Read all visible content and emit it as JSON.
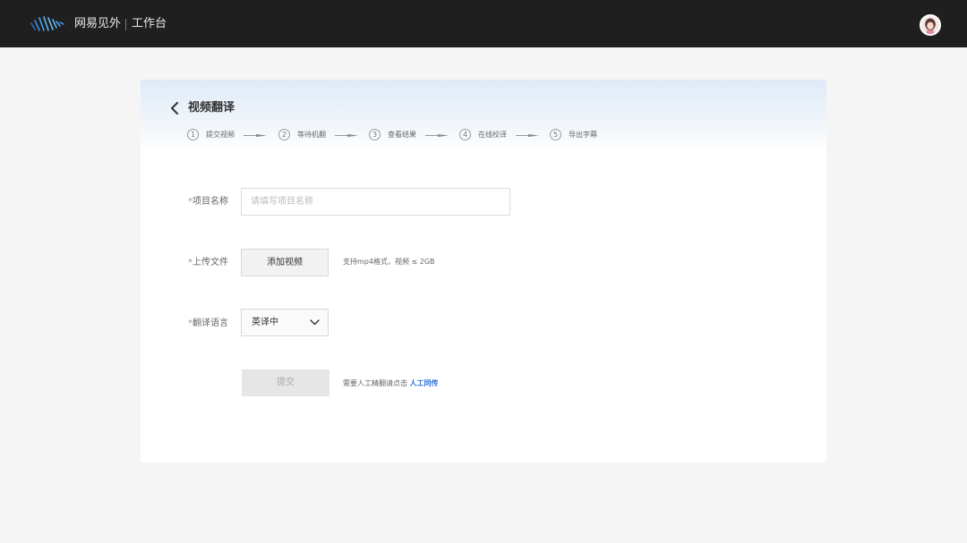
{
  "header": {
    "logo_icon": "wave-logo-icon",
    "brand": "网易见外",
    "workspace": "工作台",
    "avatar_icon": "user-avatar-icon"
  },
  "page": {
    "title": "视频翻译",
    "back_icon": "chevron-left-icon",
    "steps": [
      {
        "num": "1",
        "label": "提交视频"
      },
      {
        "num": "2",
        "label": "等待机翻"
      },
      {
        "num": "3",
        "label": "查看结果"
      },
      {
        "num": "4",
        "label": "在线校译"
      },
      {
        "num": "5",
        "label": "导出字幕"
      }
    ]
  },
  "form": {
    "project_name": {
      "star": "*",
      "label": "项目名称",
      "placeholder": "请填写项目名称",
      "value": ""
    },
    "upload": {
      "star": "*",
      "label": "上传文件",
      "button": "添加视频",
      "hint": "支持mp4格式，视频 ≤ 2GB"
    },
    "language": {
      "star": "*",
      "label": "翻译语言",
      "value": "英译中",
      "icon": "chevron-down-icon"
    },
    "submit": "提交",
    "manual_hint": "需要人工精翻请点击",
    "manual_link": "人工同传"
  },
  "colors": {
    "topbar": "#1f1f1f",
    "link": "#2a6fd6",
    "logo_blue": "#3a8ee6"
  }
}
